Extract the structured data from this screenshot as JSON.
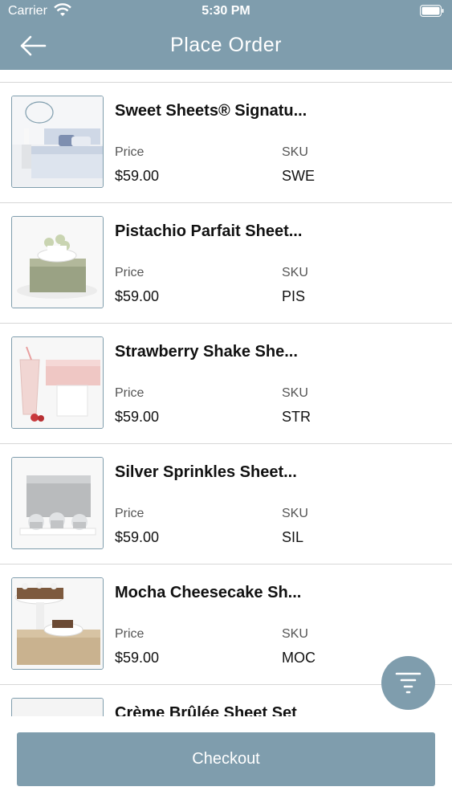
{
  "status_bar": {
    "carrier": "Carrier",
    "time": "5:30 PM"
  },
  "nav": {
    "title": "Place Order"
  },
  "columns": {
    "price_label": "Price",
    "sku_label": "SKU"
  },
  "products": [
    {
      "name": "Sweet Sheets® Signatu...",
      "price": "$59.00",
      "sku": "SWE",
      "image": "bedroom-with-logo"
    },
    {
      "name": "Pistachio Parfait Sheet...",
      "price": "$59.00",
      "sku": "PIS",
      "image": "green-sheets-with-cupcakes"
    },
    {
      "name": "Strawberry Shake She...",
      "price": "$59.00",
      "sku": "STR",
      "image": "pink-sheets-with-milkshake"
    },
    {
      "name": "Silver Sprinkles Sheet...",
      "price": "$59.00",
      "sku": "SIL",
      "image": "silver-sheets-with-cupcakes"
    },
    {
      "name": "Mocha Cheesecake Sh...",
      "price": "$59.00",
      "sku": "MOC",
      "image": "tan-sheets-with-cake"
    },
    {
      "name": "Crème Brûlée Sheet Set",
      "price": "",
      "sku": "",
      "image": "cream-sheets"
    }
  ],
  "filter_icon": "filter-icon",
  "checkout": {
    "label": "Checkout"
  },
  "colors": {
    "accent": "#7f9dad",
    "divider": "#d7d7d7"
  }
}
